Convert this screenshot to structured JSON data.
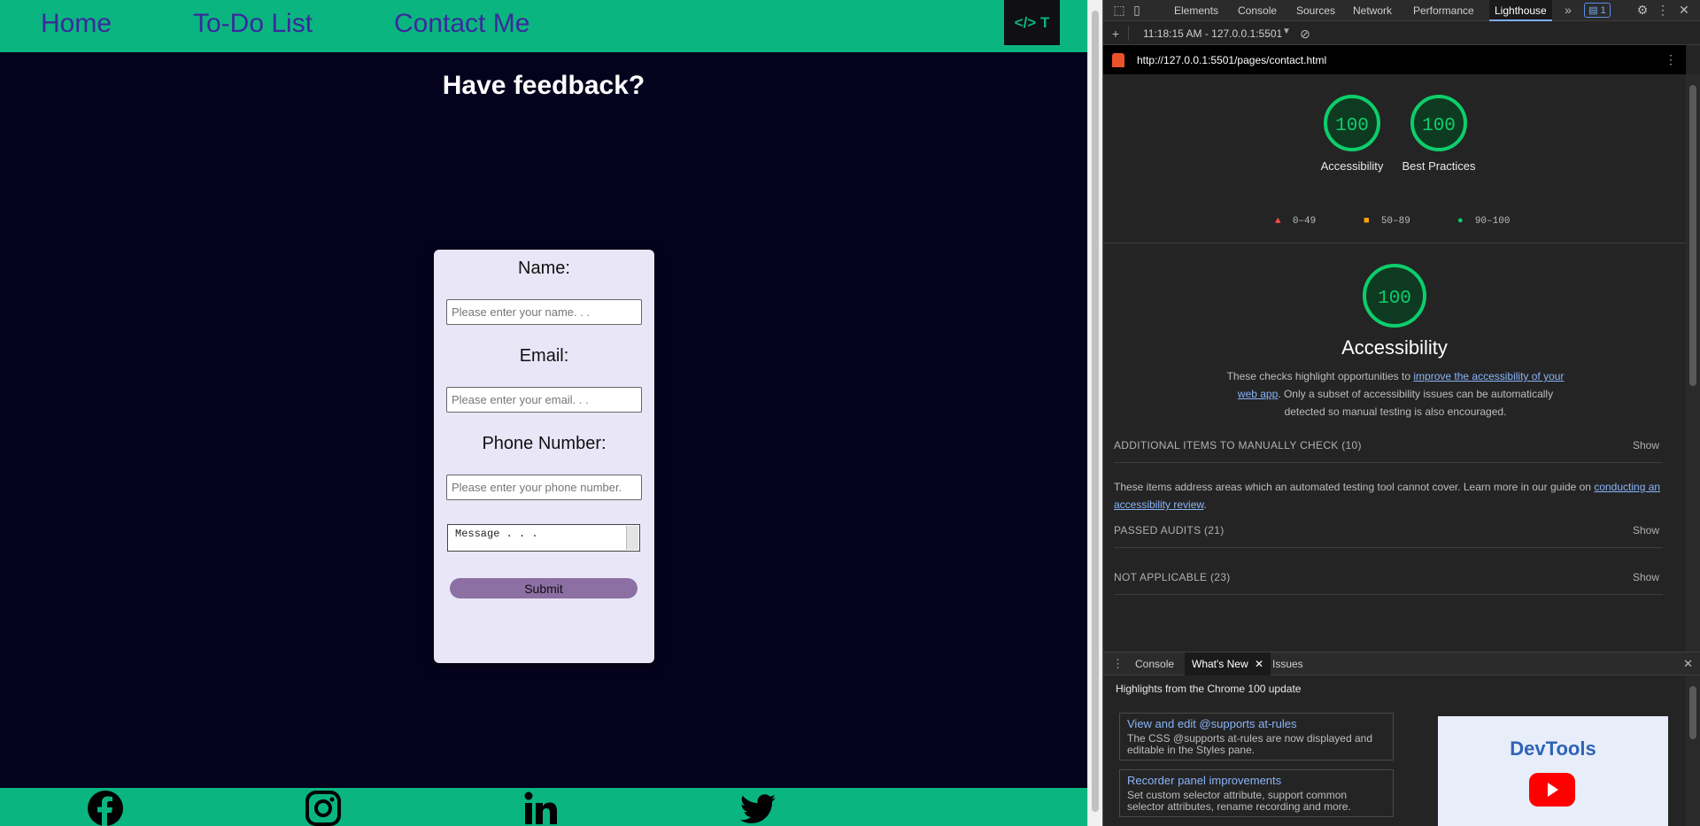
{
  "nav": {
    "home": "Home",
    "todo": "To-Do List",
    "contact": "Contact Me",
    "logo": "</> T"
  },
  "main": {
    "heading": "Have feedback?"
  },
  "form": {
    "name_label": "Name:",
    "name_placeholder": "Please enter your name. . .",
    "email_label": "Email:",
    "email_placeholder": "Please enter your email. . .",
    "phone_label": "Phone Number:",
    "phone_placeholder": "Please enter your phone number.",
    "message_placeholder": "Message . . .",
    "submit_label": "Submit"
  },
  "footer": {
    "icons": [
      "facebook-icon",
      "instagram-icon",
      "linkedin-icon",
      "twitter-icon"
    ]
  },
  "devtools": {
    "tabs": [
      "Elements",
      "Console",
      "Sources",
      "Network",
      "Performance",
      "Lighthouse"
    ],
    "active_tab": "Lighthouse",
    "issues_badge": "1",
    "report_time": "11:18:15 AM - 127.0.0.1:5501",
    "url": "http://127.0.0.1:5501/pages/contact.html",
    "gauges": [
      {
        "score": "100",
        "label": "Accessibility"
      },
      {
        "score": "100",
        "label": "Best Practices"
      }
    ],
    "legend": [
      "0–49",
      "50–89",
      "90–100"
    ],
    "category": {
      "score": "100",
      "title": "Accessibility",
      "desc_before": "These checks highlight opportunities to ",
      "desc_link": "improve the accessibility of your web app",
      "desc_after": ". Only a subset of accessibility issues can be automatically detected so manual testing is also encouraged."
    },
    "sections": [
      {
        "title": "ADDITIONAL ITEMS TO MANUALLY CHECK (10)",
        "action": "Show"
      },
      {
        "title": "PASSED AUDITS (21)",
        "action": "Show"
      },
      {
        "title": "NOT APPLICABLE (23)",
        "action": "Show"
      }
    ],
    "items_desc": {
      "before": "These items address areas which an automated testing tool cannot cover. Learn more in our guide on ",
      "link": "conducting an accessibility review",
      "after": "."
    },
    "drawer": {
      "tabs": [
        "Console",
        "What's New",
        "Issues"
      ],
      "active_tab": "What's New",
      "title": "Highlights from the Chrome 100 update",
      "news": [
        {
          "title": "View and edit @supports at-rules",
          "body": "The CSS @supports at-rules are now displayed and editable in the Styles pane."
        },
        {
          "title": "Recorder panel improvements",
          "body": "Set custom selector attribute, support common selector attributes, rename recording and more."
        }
      ],
      "promo": "DevTools"
    }
  },
  "colors": {
    "accent_green": "#0ab580",
    "nav_link": "#3a2a9c",
    "page_bg": "#05021e",
    "card_bg": "#e8e6f7",
    "submit_bg": "#8c6fa3",
    "score_green": "#0cce6b"
  }
}
